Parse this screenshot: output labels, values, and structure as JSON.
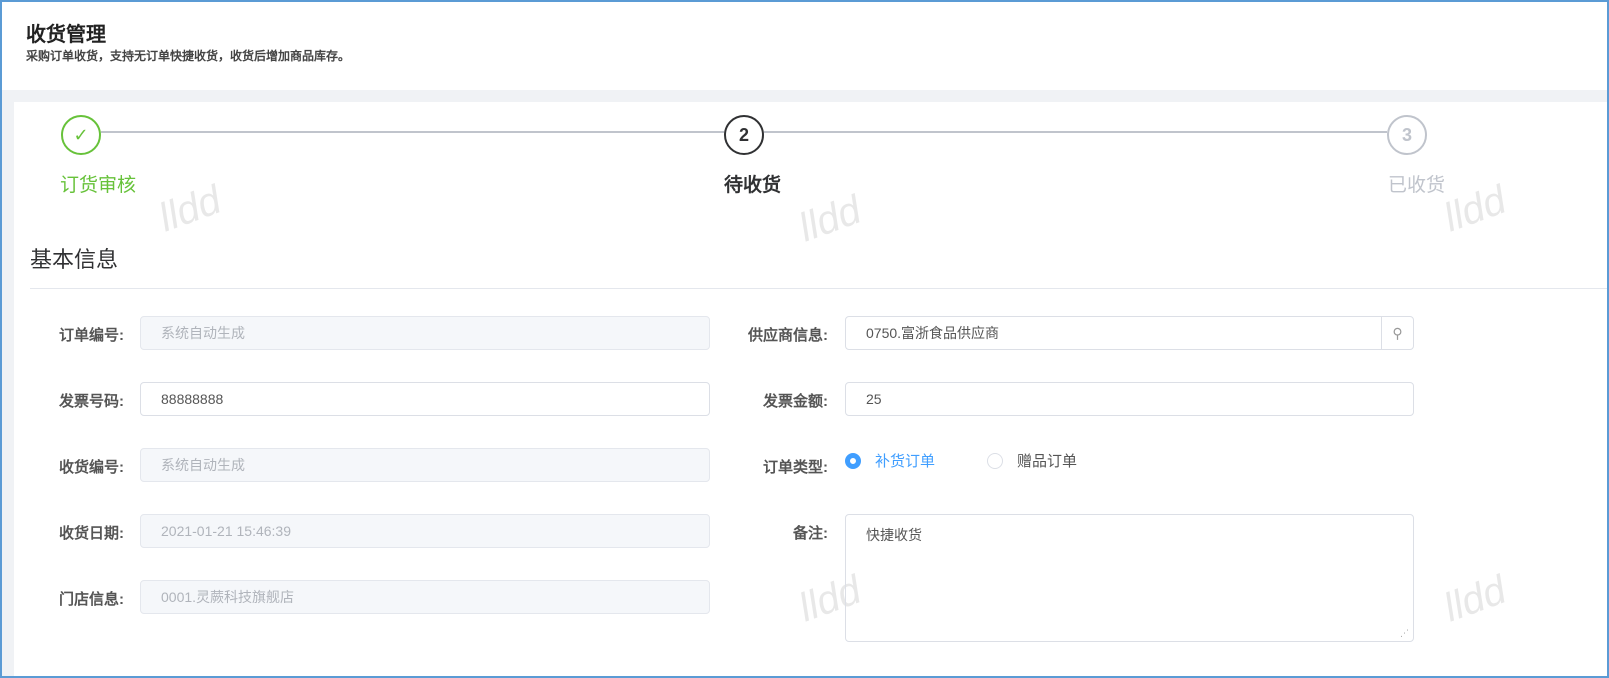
{
  "header": {
    "title": "收货管理",
    "subtitle": "采购订单收货，支持无订单快捷收货，收货后增加商品库存。"
  },
  "steps": [
    {
      "number": "1",
      "label": "订货审核",
      "status": "finished"
    },
    {
      "number": "2",
      "label": "待收货",
      "status": "process"
    },
    {
      "number": "3",
      "label": "已收货",
      "status": "wait"
    }
  ],
  "section_title": "基本信息",
  "form": {
    "order_no": {
      "label": "订单编号:",
      "placeholder": "系统自动生成"
    },
    "invoice_no": {
      "label": "发票号码:",
      "value": "88888888"
    },
    "receipt_no": {
      "label": "收货编号:",
      "placeholder": "系统自动生成"
    },
    "receipt_date": {
      "label": "收货日期:",
      "value": "2021-01-21 15:46:39"
    },
    "store": {
      "label": "门店信息:",
      "value": "0001.灵蕨科技旗舰店"
    },
    "supplier": {
      "label": "供应商信息:",
      "value": "0750.富浙食品供应商"
    },
    "invoice_amount": {
      "label": "发票金额:",
      "value": "25"
    },
    "order_type": {
      "label": "订单类型:",
      "options": [
        "补货订单",
        "赠品订单"
      ],
      "selected": "补货订单"
    },
    "remark": {
      "label": "备注:",
      "value": "快捷收货"
    }
  },
  "watermark": "lldd",
  "colors": {
    "success": "#67c23a",
    "primary": "#409eff",
    "border": "#5b9bd5"
  }
}
